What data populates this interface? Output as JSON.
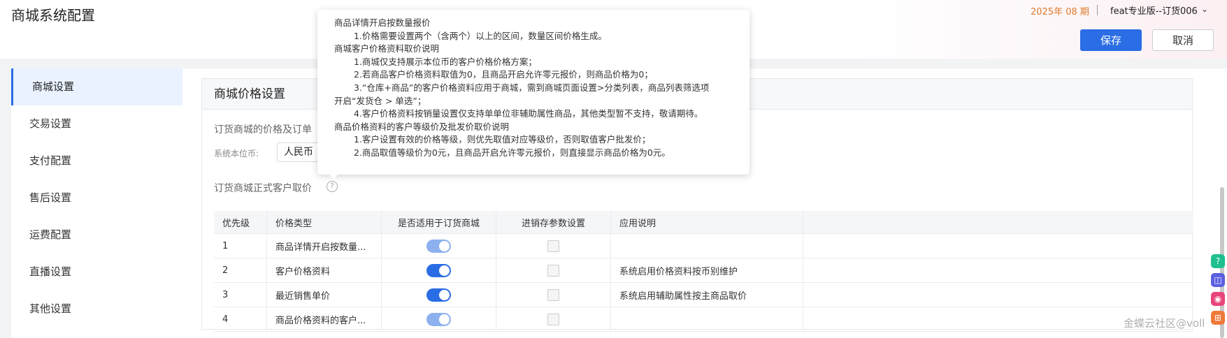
{
  "header": {
    "title": "商城系统配置",
    "period": "2025年 08 期",
    "org": "feat专业版--订货006",
    "save_label": "保存",
    "cancel_label": "取消"
  },
  "sidebar": {
    "items": [
      "商城设置",
      "交易设置",
      "支付配置",
      "售后设置",
      "运费配置",
      "直播设置",
      "其他设置"
    ]
  },
  "panel": {
    "title": "商城价格设置",
    "section_desc": "订货商城的价格及订单",
    "currency_label": "系统本位币:",
    "currency_value": "人民币",
    "pricing_label": "订货商城正式客户取价",
    "help_icon": "?"
  },
  "table": {
    "headers": [
      "优先级",
      "价格类型",
      "是否适用于订货商城",
      "进销存参数设置",
      "应用说明",
      ""
    ],
    "rows": [
      {
        "priority": "1",
        "type": "商品详情开启按数量...",
        "desc": ""
      },
      {
        "priority": "2",
        "type": "客户价格资料",
        "desc": "系统启用价格资料按币别维护"
      },
      {
        "priority": "3",
        "type": "最近销售单价",
        "desc": "系统启用辅助属性按主商品取价"
      },
      {
        "priority": "4",
        "type": "商品价格资料的客户...",
        "desc": ""
      }
    ]
  },
  "tooltip": {
    "lines": [
      "商品详情开启按数量报价",
      "1.价格需要设置两个（含两个）以上的区间，数量区间价格生成。",
      "商城客户价格资料取价说明",
      "1.商城仅支持展示本位币的客户价格价格方案；",
      "2.若商品客户价格资料取值为0，且商品开启允许零元报价，则商品价格为0；",
      "3.“仓库+商品”的客户价格资料应用于商城，需到商城页面设置>分类列表，商品列表筛选项",
      "开启“发货仓 > 单选”；",
      "4.客户价格资料按销量设置仅支持单单位非辅助属性商品，其他类型暂不支持，敬请期待。",
      "商品价格资料的客户等级价及批发价取价说明",
      "1.客户设置有效的价格等级，则优先取值对应等级价，否则取值客户批发价；",
      "2.商品取值等级价为0元，且商品开启允许零元报价，则直接显示商品价格为0元。"
    ]
  },
  "float_buttons": [
    "?",
    "◫",
    "◉",
    "⊞"
  ],
  "watermark": "金蝶云社区@voll",
  "colors": {
    "primary": "#2a6de5",
    "period": "#e07a2a"
  }
}
